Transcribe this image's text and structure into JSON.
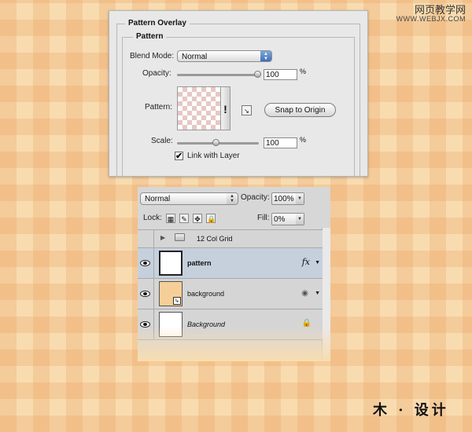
{
  "watermark": {
    "line1": "网页教学网",
    "line2": "WWW.WEBJX.COM"
  },
  "pattern_overlay": {
    "title": "Pattern Overlay",
    "group_title": "Pattern",
    "blend_mode_label": "Blend Mode:",
    "blend_mode_value": "Normal",
    "opacity_label": "Opacity:",
    "opacity_value": "100",
    "opacity_unit": "%",
    "pattern_label": "Pattern:",
    "snap_button": "Snap to Origin",
    "scale_label": "Scale:",
    "scale_value": "100",
    "scale_unit": "%",
    "link_label": "Link with Layer",
    "link_checked": "✔"
  },
  "layers_panel": {
    "blend_mode": "Normal",
    "opacity_label": "Opacity:",
    "opacity_value": "100%",
    "lock_label": "Lock:",
    "fill_label": "Fill:",
    "fill_value": "0%",
    "layers": [
      {
        "name": "12 Col Grid",
        "type": "group"
      },
      {
        "name": "pattern",
        "badge": "fx",
        "selected": true
      },
      {
        "name": "background"
      },
      {
        "name": "Background",
        "locked": true
      }
    ]
  },
  "footer": {
    "text": "木 · 设计"
  },
  "colors": {
    "selected_row": "#c6d0dd",
    "row": "#d5d5d5",
    "accent": "#3f6fb8"
  }
}
